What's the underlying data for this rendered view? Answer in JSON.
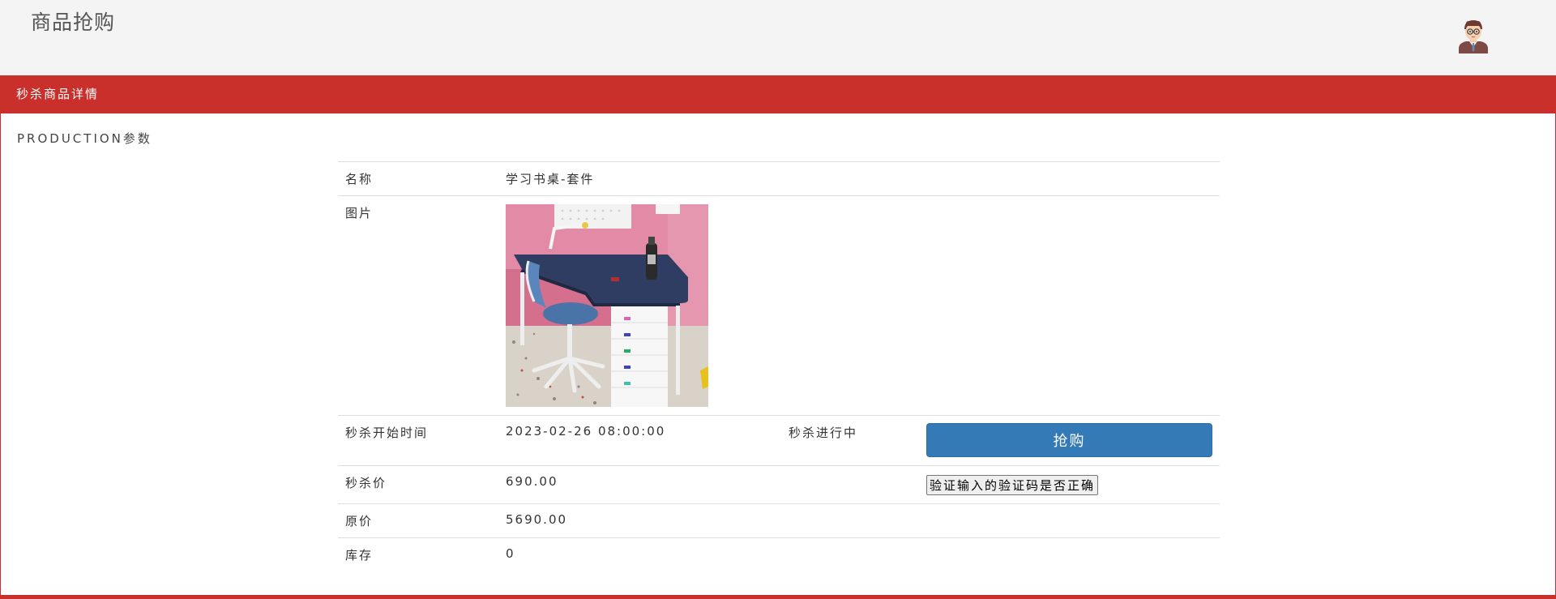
{
  "header": {
    "title": "商品抢购",
    "avatar_icon": "user-avatar-icon"
  },
  "panel": {
    "heading": "秒杀商品详情",
    "subtitle": "PRODUCTION参数"
  },
  "product": {
    "name_label": "名称",
    "name_value": "学习书桌-套件",
    "image_label": "图片",
    "start_time_label": "秒杀开始时间",
    "start_time_value": "2023-02-26 08:00:00",
    "status": "秒杀进行中",
    "buy_button": "抢购",
    "seckill_price_label": "秒杀价",
    "seckill_price_value": "690.00",
    "verify_button": "验证输入的验证码是否正确",
    "original_price_label": "原价",
    "original_price_value": "5690.00",
    "stock_label": "库存",
    "stock_value": "0"
  },
  "colors": {
    "accent": "#c9302c",
    "primary_button": "#337ab7"
  }
}
